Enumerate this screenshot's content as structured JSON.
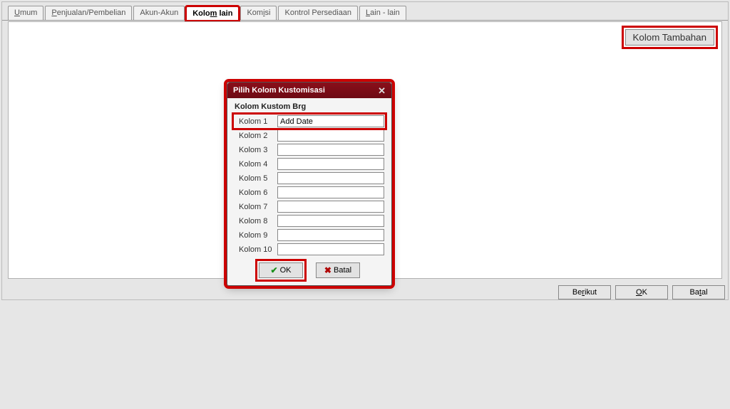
{
  "tabs": {
    "umum": "Umum",
    "penjualan": "Penjualan/Pembelian",
    "akun": "Akun-Akun",
    "kolom_lain": "Kolom lain",
    "komisi": "Komisi",
    "kontrol": "Kontrol Persediaan",
    "lain": "Lain - lain"
  },
  "toolbar": {
    "kolom_tambahan": "Kolom Tambahan"
  },
  "bottom": {
    "berikut": "Berikut",
    "ok": "OK",
    "batal": "Batal"
  },
  "dialog": {
    "title": "Pilih Kolom Kustomisasi",
    "group": "Kolom Kustom Brg",
    "rows": [
      {
        "label": "Kolom 1",
        "value": "Add Date"
      },
      {
        "label": "Kolom 2",
        "value": ""
      },
      {
        "label": "Kolom 3",
        "value": ""
      },
      {
        "label": "Kolom 4",
        "value": ""
      },
      {
        "label": "Kolom 5",
        "value": ""
      },
      {
        "label": "Kolom 6",
        "value": ""
      },
      {
        "label": "Kolom 7",
        "value": ""
      },
      {
        "label": "Kolom 8",
        "value": ""
      },
      {
        "label": "Kolom 9",
        "value": ""
      },
      {
        "label": "Kolom 10",
        "value": ""
      }
    ],
    "ok": "OK",
    "batal": "Batal"
  }
}
